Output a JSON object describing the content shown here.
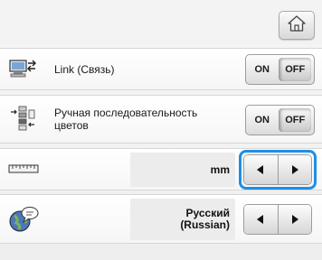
{
  "header": {
    "home_icon": "home-icon"
  },
  "settings": {
    "link": {
      "label": "Link (Связь)",
      "icon": "pc-link-icon",
      "toggle": {
        "on_label": "ON",
        "off_label": "OFF",
        "selected": "OFF"
      }
    },
    "color_sequence": {
      "label": "Ручная последовательность цветов",
      "icon": "color-sequence-icon",
      "toggle": {
        "on_label": "ON",
        "off_label": "OFF",
        "selected": "OFF"
      }
    },
    "units": {
      "icon": "ruler-icon",
      "value": "mm",
      "selected_highlight_color": "#1d8fe6"
    },
    "language": {
      "icon": "globe-speech-icon",
      "value": "Русский\n(Russian)"
    }
  }
}
